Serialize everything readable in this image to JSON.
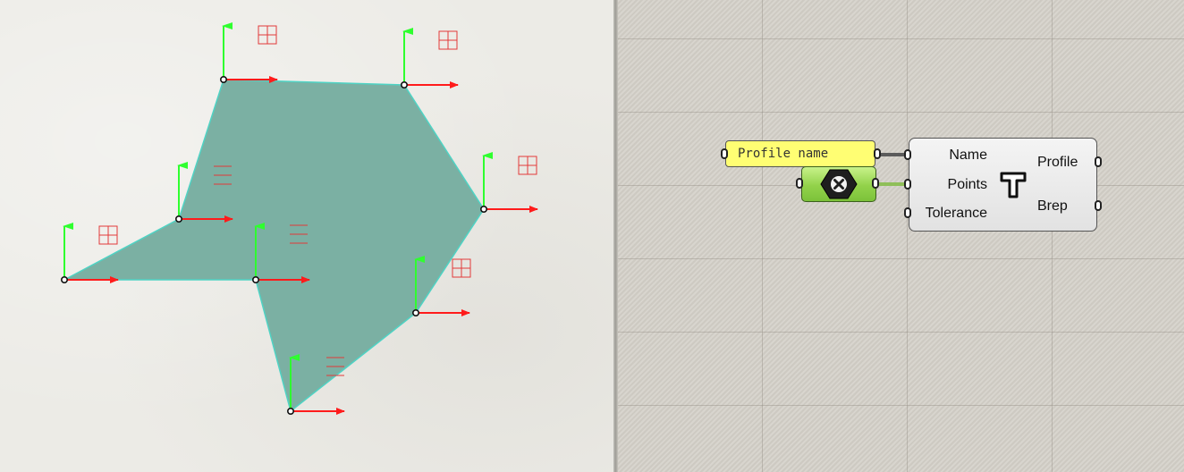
{
  "viewport": {
    "fill_color": "#7bb0a3",
    "edge_color": "#4fd3c4",
    "x_axis_color": "#ff1b1b",
    "y_axis_color": "#2fff2f",
    "frame_icon": "grid-frame-icon"
  },
  "canvas": {
    "panel": {
      "text": "Profile name"
    },
    "params_node": {
      "icon": "close-hexagon-icon"
    },
    "component": {
      "inputs": [
        "Name",
        "Points",
        "Tolerance"
      ],
      "outputs": [
        "Profile",
        "Brep"
      ],
      "icon": "t-profile-icon"
    }
  }
}
